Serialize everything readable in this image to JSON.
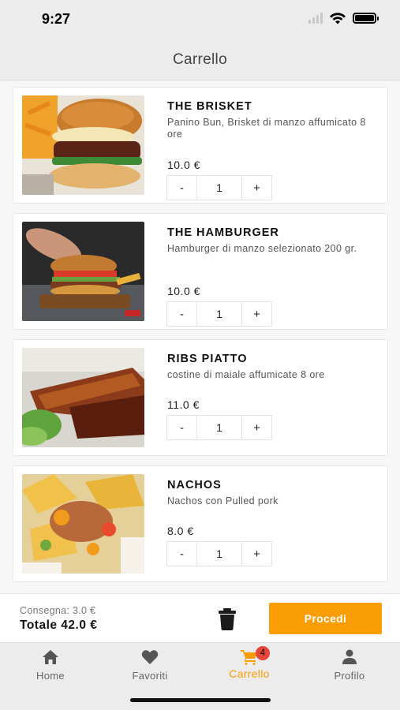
{
  "status_bar": {
    "time": "9:27"
  },
  "header": {
    "title": "Carrello"
  },
  "cart": {
    "items": [
      {
        "name": "THE BRISKET",
        "description": "Panino Bun, Brisket di manzo affumicato 8 ore",
        "price": "10.0 €",
        "quantity": "1",
        "decrement": "-",
        "increment": "+"
      },
      {
        "name": "THE HAMBURGER",
        "description": "Hamburger di manzo selezionato 200 gr.",
        "price": "10.0 €",
        "quantity": "1",
        "decrement": "-",
        "increment": "+"
      },
      {
        "name": "RIBS PIATTO",
        "description": "costine di maiale affumicate 8 ore",
        "price": "11.0 €",
        "quantity": "1",
        "decrement": "-",
        "increment": "+"
      },
      {
        "name": "NACHOS",
        "description": "Nachos con Pulled pork",
        "price": "8.0 €",
        "quantity": "1",
        "decrement": "-",
        "increment": "+"
      }
    ]
  },
  "summary": {
    "delivery": "Consegna: 3.0 €",
    "total": "Totale 42.0 €",
    "proceed_label": "Procedi",
    "trash_icon": "trash-icon"
  },
  "tabs": [
    {
      "label": "Home",
      "icon": "home-icon"
    },
    {
      "label": "Favoriti",
      "icon": "heart-icon"
    },
    {
      "label": "Carrello",
      "icon": "cart-icon",
      "badge": "4",
      "active": true
    },
    {
      "label": "Profilo",
      "icon": "user-icon"
    }
  ],
  "colors": {
    "accent": "#fb9d05",
    "badge": "#e7443a"
  }
}
